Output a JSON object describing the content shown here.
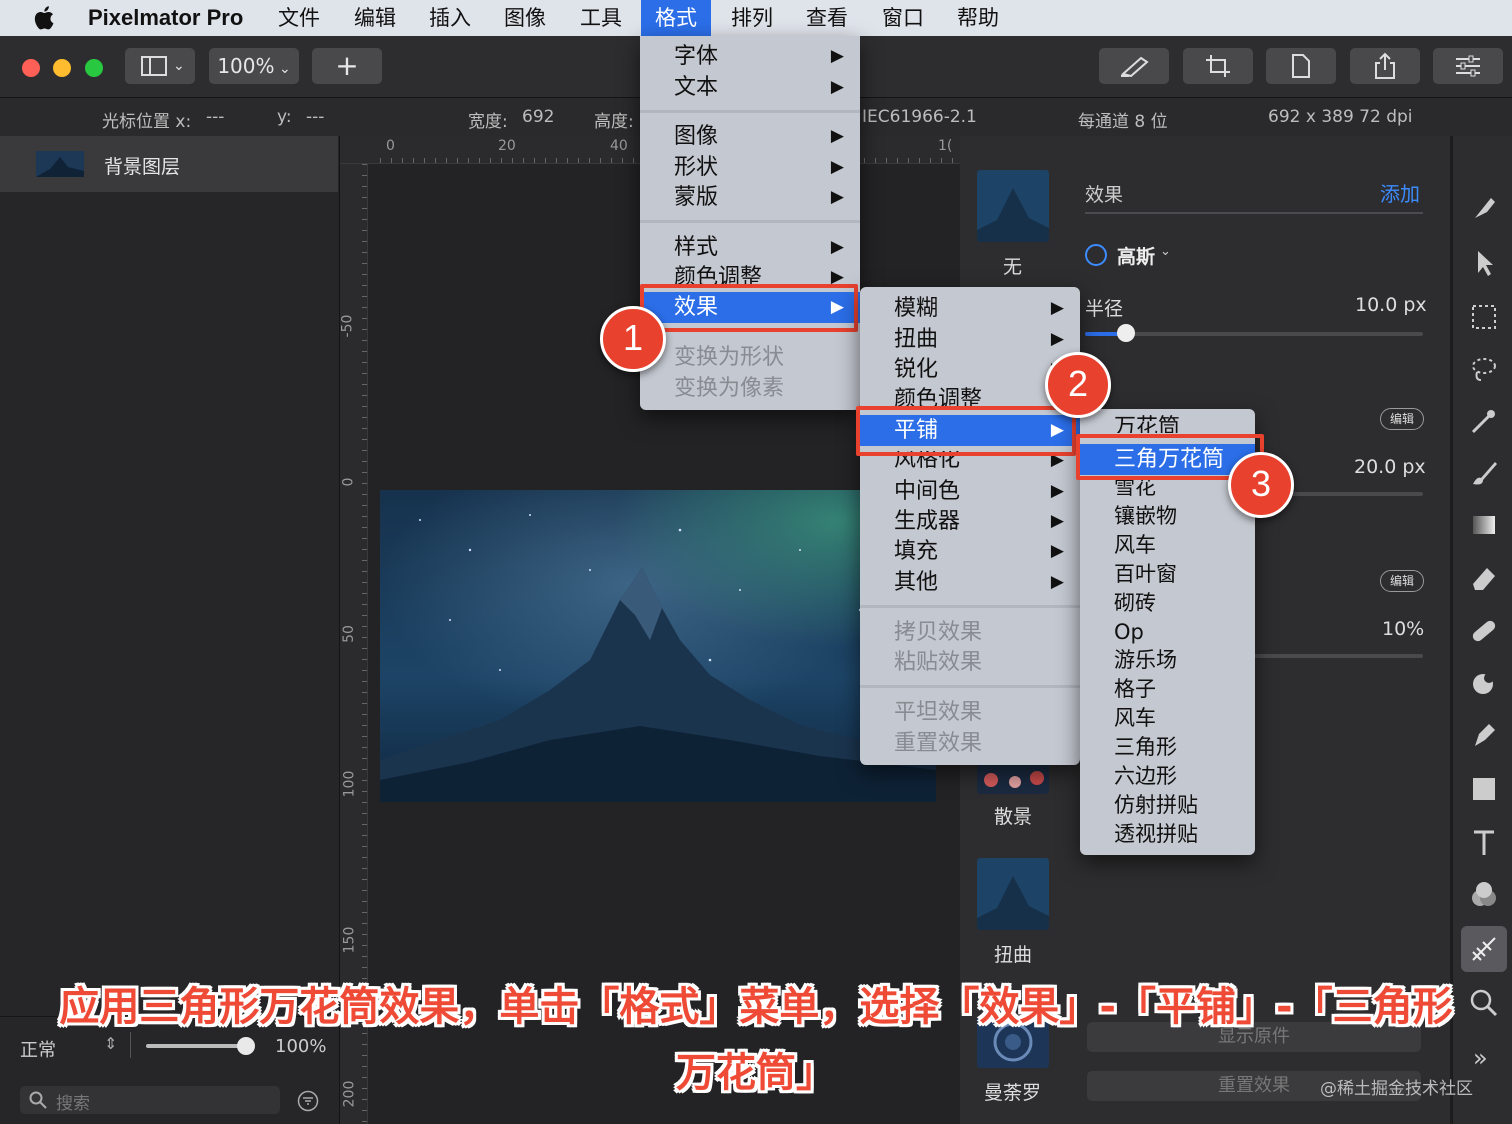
{
  "menubar": {
    "app_name": "Pixelmator Pro",
    "items": [
      "文件",
      "编辑",
      "插入",
      "图像",
      "工具",
      "格式",
      "排列",
      "查看",
      "窗口",
      "帮助"
    ]
  },
  "toolbar": {
    "zoom": "100%",
    "add": "+"
  },
  "infobar": {
    "cursor_x_label": "光标位置 x:",
    "cursor_x_value": "---",
    "cursor_y_label": "y:",
    "cursor_y_value": "---",
    "width_label": "宽度:",
    "width_value": "692",
    "height_label": "高度:",
    "color_profile": "IEC61966-2.1",
    "bit_depth": "每通道 8 位",
    "dims": "692 x 389 72 dpi"
  },
  "layers": {
    "items": [
      {
        "name": "背景图层"
      }
    ],
    "blend_mode": "正常",
    "opacity": "100%",
    "search_placeholder": "搜索"
  },
  "rulers": {
    "top": [
      "0",
      "20",
      "40",
      "1("
    ],
    "left": [
      "-50",
      "0",
      "50",
      "100",
      "150",
      "200"
    ]
  },
  "format_menu": {
    "group1": [
      "字体",
      "文本"
    ],
    "group2": [
      "图像",
      "形状",
      "蒙版"
    ],
    "group3": [
      "样式",
      "颜色调整"
    ],
    "selected": "效果",
    "group4": [
      "变换为形状",
      "变换为像素"
    ]
  },
  "effects_menu": {
    "group1": [
      "模糊",
      "扭曲",
      "锐化",
      "颜色调整"
    ],
    "selected": "平铺",
    "group2": [
      "风格化",
      "中间色",
      "生成器",
      "填充",
      "其他"
    ],
    "group3": [
      "拷贝效果",
      "粘贴效果"
    ],
    "group4": [
      "平坦效果",
      "重置效果"
    ]
  },
  "tile_menu": {
    "first": "万花筒",
    "selected": "三角万花筒",
    "items": [
      "雪花",
      "镶嵌物",
      "风车",
      "百叶窗",
      "砌砖",
      "Op",
      "游乐场",
      "格子",
      "风车",
      "三角形",
      "六边形",
      "仿射拼贴",
      "透视拼贴"
    ]
  },
  "badges": [
    "1",
    "2",
    "3"
  ],
  "effects_panel": {
    "title": "效果",
    "add": "添加",
    "thumbs": [
      "无",
      "散景",
      "扭曲",
      "曼荼罗"
    ],
    "blur_type": "高斯",
    "radius_label": "半径",
    "radius_value": "10.0 px",
    "value2": "20.0 px",
    "value3": "10%",
    "edit1": "编辑",
    "edit2": "编辑",
    "show_original": "显示原件",
    "reset": "重置效果",
    "watermark": "@稀土掘金技术社区"
  },
  "caption": {
    "line1": "应用三角形万花筒效果，单击「格式」菜单，选择「效果」-「平铺」-「三角形",
    "line2": "万花筒」"
  },
  "colors": {
    "accent": "#2b6ee8",
    "annotation": "#e8412e"
  }
}
